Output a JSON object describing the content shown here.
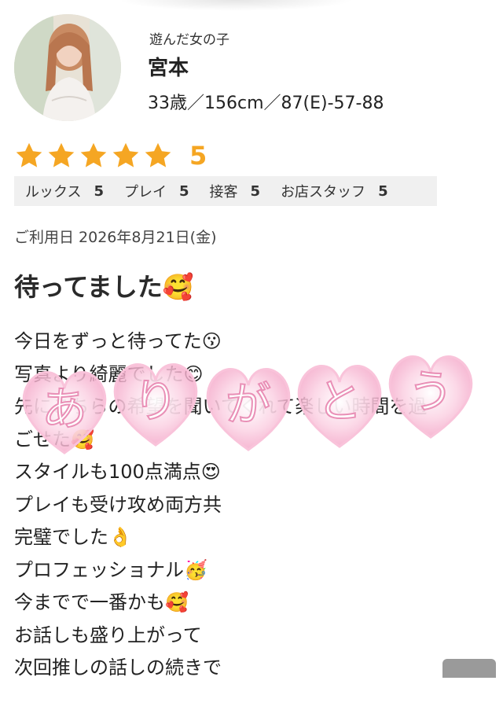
{
  "profile": {
    "label": "遊んだ女の子",
    "name": "宮本",
    "specs": "33歳／156cm／87(E)-57-88"
  },
  "rating": {
    "stars": 5,
    "value": "5",
    "star_color": "#f5a623",
    "sub": [
      {
        "label": "ルックス",
        "score": "5"
      },
      {
        "label": "プレイ",
        "score": "5"
      },
      {
        "label": "接客",
        "score": "5"
      },
      {
        "label": "お店スタッフ",
        "score": "5"
      }
    ]
  },
  "visit_date": "ご利用日 2026年8月21日(金)",
  "review": {
    "title": "待ってました🥰",
    "lines": [
      "今日をずっと待ってた😗",
      "写真より綺麗でした😊",
      "先にこちらの希望を聞いてくれて楽しい時間を過",
      "ごせた🥰",
      "スタイルも100点満点😍",
      "プレイも受け攻め両方共",
      "完璧でした👌",
      "プロフェッショナル🥳",
      "今までで一番かも🥰",
      "お話しも盛り上がって",
      "次回推しの話しの続きで"
    ]
  },
  "sticker": {
    "chars": [
      "あ",
      "り",
      "が",
      "と",
      "う"
    ],
    "heart_color": "#f7b3cf"
  }
}
